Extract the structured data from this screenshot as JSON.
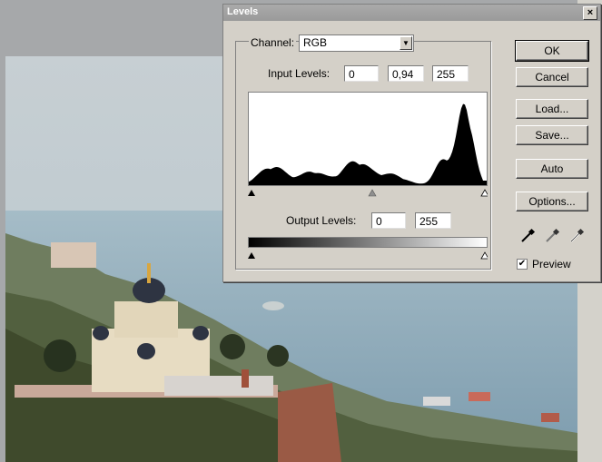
{
  "dialog": {
    "title": "Levels",
    "close_glyph": "×",
    "channel_label": "Channel:",
    "channel_value": "RGB",
    "input_levels_label": "Input Levels:",
    "input_levels": [
      "0",
      "0,94",
      "255"
    ],
    "output_levels_label": "Output Levels:",
    "output_levels": [
      "0",
      "255"
    ],
    "buttons": {
      "ok": "OK",
      "cancel": "Cancel",
      "load": "Load...",
      "save": "Save...",
      "auto": "Auto",
      "options": "Options..."
    },
    "preview_label": "Preview",
    "preview_checked": true,
    "eyedroppers": [
      "black-eyedropper-icon",
      "gray-eyedropper-icon",
      "white-eyedropper-icon"
    ]
  }
}
